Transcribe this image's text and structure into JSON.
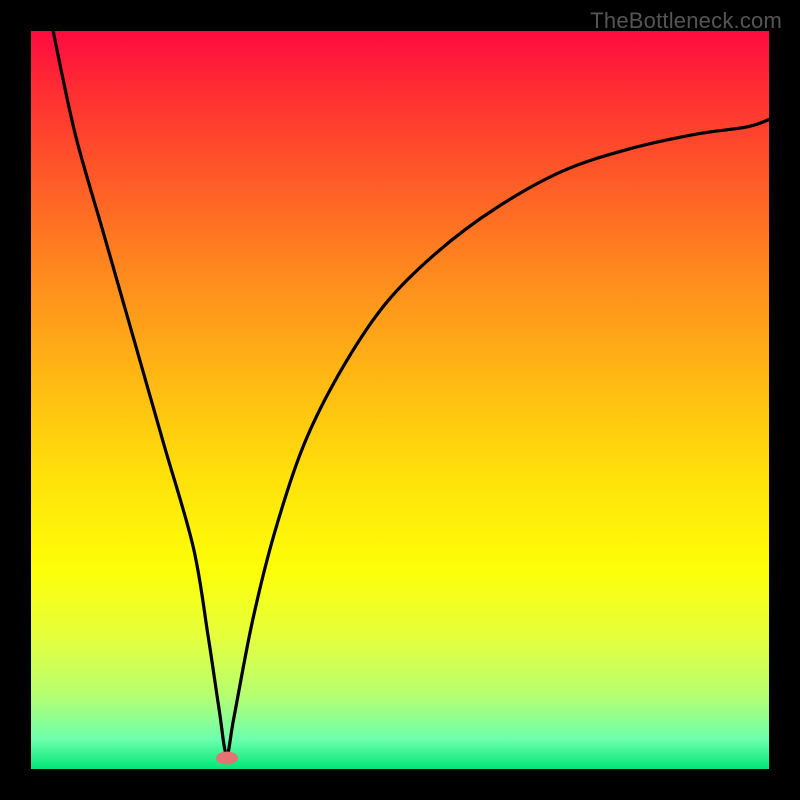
{
  "watermark": "TheBottleneck.com",
  "chart_data": {
    "type": "line",
    "title": "",
    "xlabel": "",
    "ylabel": "",
    "xlim": [
      0,
      100
    ],
    "ylim": [
      0,
      100
    ],
    "grid": false,
    "legend": false,
    "gradient": "bottleneck-red-to-green",
    "series": [
      {
        "name": "bottleneck-curve",
        "x": [
          3,
          6,
          10,
          14,
          18,
          22,
          24,
          25.5,
          26.5,
          27.5,
          30,
          33,
          37,
          42,
          48,
          55,
          63,
          72,
          81,
          90,
          97,
          100
        ],
        "values": [
          100,
          86,
          72,
          58,
          44,
          30,
          18,
          8,
          2,
          7,
          20,
          32,
          44,
          54,
          63,
          70,
          76,
          81,
          84,
          86,
          87,
          88
        ]
      }
    ],
    "marker": {
      "x": 26.5,
      "y": 1.5,
      "color": "#e57373",
      "shape": "ellipse"
    }
  }
}
